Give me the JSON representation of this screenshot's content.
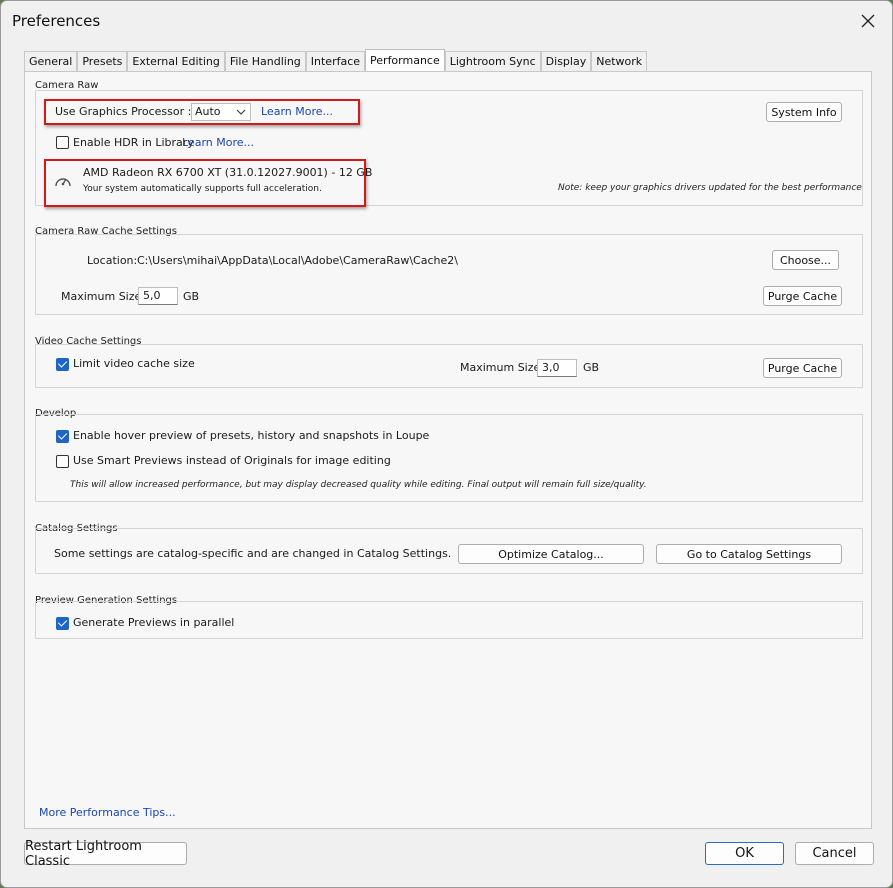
{
  "window": {
    "title": "Preferences"
  },
  "tabs": [
    "General",
    "Presets",
    "External Editing",
    "File Handling",
    "Interface",
    "Performance",
    "Lightroom Sync",
    "Display",
    "Network"
  ],
  "active_tab": "Performance",
  "camera_raw": {
    "title": "Camera Raw",
    "gpu_label": "Use Graphics Processor :",
    "gpu_value": "Auto",
    "learn_more_1": "Learn More...",
    "system_info": "System Info",
    "hdr_label": "Enable HDR in Library",
    "learn_more_2": "Learn More...",
    "gpu_name": "AMD Radeon RX 6700 XT (31.0.12027.9001) - 12 GB",
    "gpu_status": "Your system automatically supports full acceleration.",
    "note": "Note: keep your graphics drivers updated for the best performance"
  },
  "cache": {
    "title": "Camera Raw Cache Settings",
    "location_label": "Location:",
    "location_value": "C:\\Users\\mihai\\AppData\\Local\\Adobe\\CameraRaw\\Cache2\\",
    "choose": "Choose...",
    "max_label": "Maximum Size:",
    "max_value": "5,0",
    "unit": "GB",
    "purge": "Purge Cache"
  },
  "video": {
    "title": "Video Cache Settings",
    "limit_label": "Limit video cache size",
    "max_label": "Maximum Size:",
    "max_value": "3,0",
    "unit": "GB",
    "purge": "Purge Cache"
  },
  "develop": {
    "title": "Develop",
    "hover_label": "Enable hover preview of presets, history and snapshots in Loupe",
    "smart_label": "Use Smart Previews instead of Originals for image editing",
    "note": "This will allow increased performance, but may display decreased quality while editing. Final output will remain full size/quality."
  },
  "catalog": {
    "title": "Catalog Settings",
    "text": "Some settings are catalog-specific and are changed in Catalog Settings.",
    "optimize": "Optimize Catalog...",
    "goto": "Go to Catalog Settings"
  },
  "preview": {
    "title": "Preview Generation Settings",
    "parallel_label": "Generate Previews in parallel"
  },
  "tips_link": "More Performance Tips...",
  "footer": {
    "restart": "Restart Lightroom Classic",
    "ok": "OK",
    "cancel": "Cancel"
  },
  "checkbox_states": {
    "hdr": false,
    "limit_video": true,
    "hover_preview": true,
    "smart_previews": false,
    "parallel": true
  },
  "colors": {
    "accent": "#1f66c4",
    "highlight": "#d11a1a",
    "link": "#1a46b0"
  },
  "icons": {
    "close": "close-icon",
    "gpu": "speedometer-icon",
    "dropdown": "chevron-down-icon"
  }
}
